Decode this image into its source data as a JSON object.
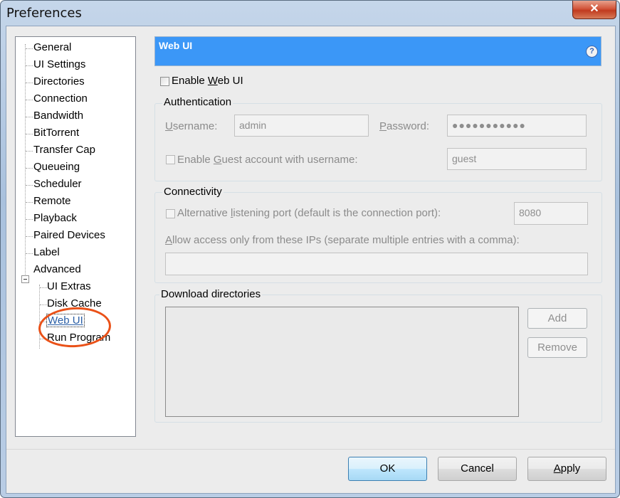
{
  "window": {
    "title": "Preferences",
    "close_label": "✕"
  },
  "tree": {
    "items": [
      "General",
      "UI Settings",
      "Directories",
      "Connection",
      "Bandwidth",
      "BitTorrent",
      "Transfer Cap",
      "Queueing",
      "Scheduler",
      "Remote",
      "Playback",
      "Paired Devices",
      "Label",
      "Advanced"
    ],
    "advanced_children": [
      "UI Extras",
      "Disk Cache",
      "Web UI",
      "Run Program"
    ]
  },
  "panel": {
    "header_title": "Web UI",
    "help_label": "?",
    "enable_label_pre": "Enable ",
    "enable_label_key": "W",
    "enable_label_post": "eb UI",
    "auth": {
      "title": "Authentication",
      "username_key": "U",
      "username_rest": "sername:",
      "username_value": "admin",
      "password_key": "P",
      "password_rest": "assword:",
      "password_value": "●●●●●●●●●●●",
      "guest_pre": "Enable ",
      "guest_key": "G",
      "guest_post": "uest account with username:",
      "guest_value": "guest"
    },
    "conn": {
      "title": "Connectivity",
      "altport_pre": "Alternative ",
      "altport_key": "l",
      "altport_post": "istening port (default is the connection port):",
      "port_value": "8080",
      "allow_key": "A",
      "allow_rest": "llow access only from these IPs (separate multiple entries with a comma):",
      "allow_value": ""
    },
    "downloads": {
      "title": "Download directories",
      "add_label": "Add",
      "remove_label": "Remove"
    }
  },
  "footer": {
    "ok_label": "OK",
    "cancel_label": "Cancel",
    "apply_key": "A",
    "apply_rest": "pply"
  },
  "colors": {
    "header_bg": "#3b97f7",
    "highlight_circle": "#ea5118"
  }
}
